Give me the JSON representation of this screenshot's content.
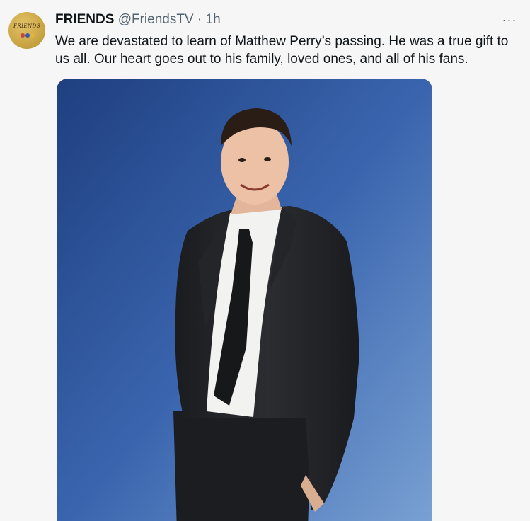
{
  "tweet": {
    "author_name": "FRIENDS",
    "handle": "@FriendsTV",
    "separator": "·",
    "time": "1h",
    "more_label": "···",
    "text": "We are devastated to learn of Matthew Perry’s passing. He was a true gift to us all. Our heart goes out to his family, loved ones, and all of his fans.",
    "avatar_word": "FRIENDS",
    "avatar_dot_colors": [
      "#d23f3a",
      "#2d5db4",
      "#e6b33a"
    ],
    "accent_colors": {
      "avatar_gold": "#caa544",
      "photo_background": "#3a66b1"
    }
  }
}
